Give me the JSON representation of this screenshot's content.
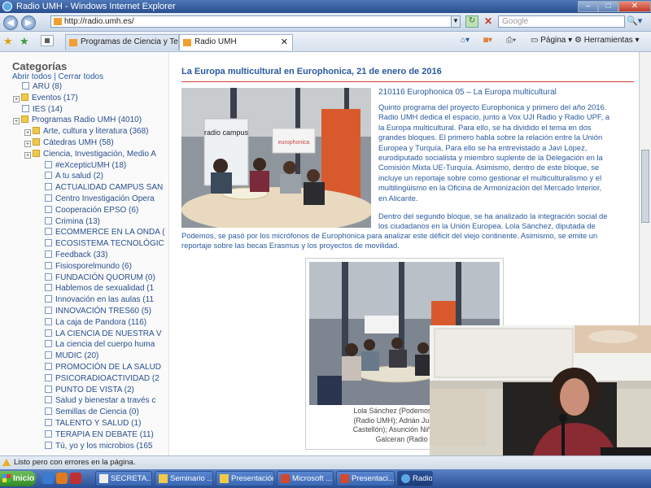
{
  "window": {
    "title": "Radio UMH - Windows Internet Explorer"
  },
  "address": {
    "url": "http://radio.umh.es/",
    "search_placeholder": "Google"
  },
  "tabs": [
    {
      "label": "Programas de Ciencia y Tecn..."
    },
    {
      "label": "Radio UMH"
    }
  ],
  "tools": {
    "page": "Página",
    "tools": "Herramientas"
  },
  "sidebar": {
    "title": "Categorías",
    "open_all": "Abrir todos",
    "close_all": "Cerrar todos",
    "items": [
      {
        "label": "ARU (8)",
        "kind": "page",
        "level": 0
      },
      {
        "label": "Eventos (17)",
        "kind": "folder",
        "level": 0
      },
      {
        "label": "IES (14)",
        "kind": "page",
        "level": 0
      },
      {
        "label": "Programas Radio UMH (4010)",
        "kind": "folder",
        "level": 0
      },
      {
        "label": "Arte, cultura y literatura (368)",
        "kind": "folder",
        "level": 1
      },
      {
        "label": "Cátedras UMH (58)",
        "kind": "folder",
        "level": 1
      },
      {
        "label": "Ciencia, Investigación, Medio A",
        "kind": "folder",
        "level": 1
      },
      {
        "label": "#eXcepticUMH (18)",
        "kind": "page",
        "level": 2
      },
      {
        "label": "A tu salud (2)",
        "kind": "page",
        "level": 2
      },
      {
        "label": "ACTUALIDAD CAMPUS SAN",
        "kind": "page",
        "level": 2
      },
      {
        "label": "Centro Investigación Opera",
        "kind": "page",
        "level": 2
      },
      {
        "label": "Cooperación EPSO (6)",
        "kind": "page",
        "level": 2
      },
      {
        "label": "Crimina (13)",
        "kind": "page",
        "level": 2
      },
      {
        "label": "ECOMMERCE EN LA ONDA (",
        "kind": "page",
        "level": 2
      },
      {
        "label": "ECOSISTEMA TECNOLÓGIC",
        "kind": "page",
        "level": 2
      },
      {
        "label": "Feedback (33)",
        "kind": "page",
        "level": 2
      },
      {
        "label": "Fisiosporelmundo (6)",
        "kind": "page",
        "level": 2
      },
      {
        "label": "FUNDACIÓN QUORUM (0)",
        "kind": "page",
        "level": 2
      },
      {
        "label": "Hablemos de sexualidad (1",
        "kind": "page",
        "level": 2
      },
      {
        "label": "Innovación en las aulas (11",
        "kind": "page",
        "level": 2
      },
      {
        "label": "INNOVACIÓN TRES60 (5)",
        "kind": "page",
        "level": 2
      },
      {
        "label": "La caja de Pandora (116)",
        "kind": "page",
        "level": 2
      },
      {
        "label": "LA CIENCIA DE NUESTRA V",
        "kind": "page",
        "level": 2
      },
      {
        "label": "La ciencia del cuerpo huma",
        "kind": "page",
        "level": 2
      },
      {
        "label": "MUDIC (20)",
        "kind": "page",
        "level": 2
      },
      {
        "label": "PROMOCIÓN DE LA SALUD",
        "kind": "page",
        "level": 2
      },
      {
        "label": "PSICORADIOACTIVIDAD (2",
        "kind": "page",
        "level": 2
      },
      {
        "label": "PUNTO DE VISTA (2)",
        "kind": "page",
        "level": 2
      },
      {
        "label": "Salud y bienestar a través c",
        "kind": "page",
        "level": 2
      },
      {
        "label": "Semillas de Ciencia (0)",
        "kind": "page",
        "level": 2
      },
      {
        "label": "TALENTO Y SALUD (1)",
        "kind": "page",
        "level": 2
      },
      {
        "label": "TERAPIA EN DEBATE (11)",
        "kind": "page",
        "level": 2
      },
      {
        "label": "Tú, yo y los microbios (165",
        "kind": "page",
        "level": 2
      }
    ]
  },
  "article": {
    "title": "La Europa multicultural en Europhonica, 21 de enero de 2016",
    "subtitle": "210116 Europhonica 05 – La Europa multicultural",
    "para1_lines": [
      "Quinto programa del proyecto Europhonica y primero del año 2016.",
      "Radio UMH dedica el espacio, junto a Vox UJI Radio y Radio UPF, a",
      "la Europa multicultural. Para ello, se ha dividido el tema en dos",
      "grandes bloques. El primero habla sobre la relación entre la Unión",
      "Europea y Turquía. Para ello se ha entrevistado a Javi López,",
      "eurodiputado socialista y miembro suplente de la Delegación en la",
      "Comisión Mixta UE-Turquía. Asimismo, dentro de este bloque, se",
      "incluye un reportaje sobre como gestionar el multiculturalismo y el",
      "multilingüismo en la Oficina de Armonización del Mercado Interior,",
      "en Alicante."
    ],
    "para2a_lines": [
      "Dentro del segundo bloque, se ha analizado la integración social de",
      "los ciudadanos en la Unión Europea. Lola Sánchez, diputada de"
    ],
    "para2b_lines": [
      "Podemos, se pasó por los micrófonos de Europhonica para analizar este déficit del viejo continente. Asimismo, se emite un",
      "reportaje sobre las becas Erasmus y los proyectos de movilidad."
    ],
    "photo1_sign_a": "radio campus",
    "photo1_sign_b": "europhonica",
    "caption_lines": [
      "Lola Sánchez (Podemos) junto c",
      "(Radio UMH); Adrián Julen del B",
      "Castellón); Asunción Niñoles (Ra",
      "Galceran (Radio U"
    ]
  },
  "status": {
    "text": "Listo pero con errores en la página."
  },
  "taskbar": {
    "start": "Inicio",
    "tasks": [
      {
        "label": "SECRETA..."
      },
      {
        "label": "Seminario ..."
      },
      {
        "label": "Presentación"
      },
      {
        "label": "Microsoft ..."
      },
      {
        "label": "Presentaci..."
      },
      {
        "label": "Radio ..."
      }
    ]
  },
  "colors": {
    "link": "#2a5aa0",
    "accent_line": "#cc3333",
    "taskbar": "#2a4f96"
  }
}
